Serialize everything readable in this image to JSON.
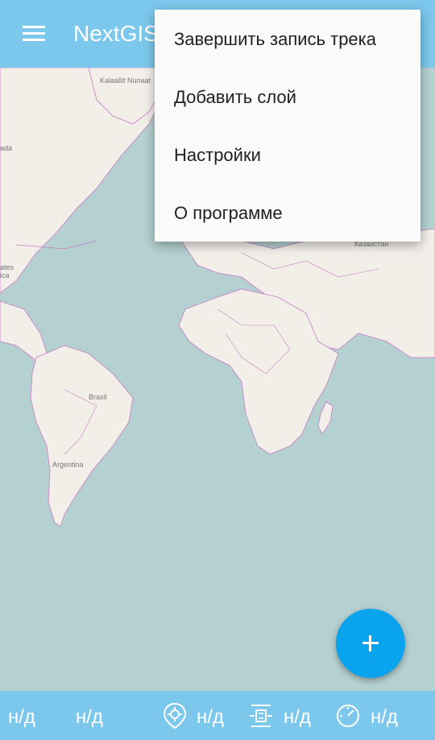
{
  "app": {
    "title": "NextGIS"
  },
  "menu": {
    "items": [
      {
        "label": "Завершить запись трека"
      },
      {
        "label": "Добавить слой"
      },
      {
        "label": "Настройки"
      },
      {
        "label": "О программе"
      }
    ]
  },
  "map": {
    "labels": {
      "greenland": "Kalaallit Nunaat",
      "brazil": "Brasil",
      "argentina": "Argentina",
      "kazakhstan": "Казахстан",
      "canada_partial": "ada",
      "states_partial_1": "ates",
      "states_partial_2": "ica"
    }
  },
  "status": {
    "accuracy": "н/д",
    "altitude": "н/д",
    "location": "н/д",
    "satellites": "н/д",
    "speed": "н/д"
  },
  "colors": {
    "toolbar": "#7cc8ec",
    "fab": "#0aa4ee",
    "water": "#b5d0d0",
    "land": "#f2efe9",
    "border": "#c77bc7"
  },
  "icons": {
    "menu": "hamburger-icon",
    "fab": "plus-icon",
    "location": "location-pin-icon",
    "satellites": "satellite-signal-icon",
    "speed": "speedometer-icon"
  }
}
